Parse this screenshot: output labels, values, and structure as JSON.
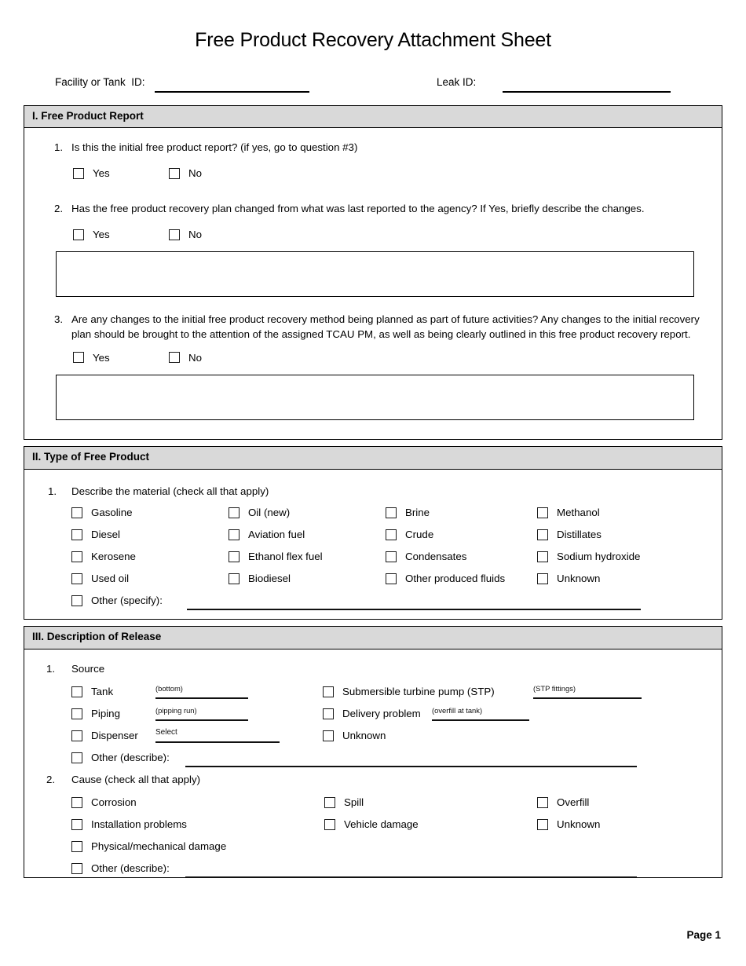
{
  "document": {
    "title": "Free Product Recovery Attachment Sheet",
    "footer": "Page 1"
  },
  "identifiers": {
    "facility_label": "Facility or Tank  ID:",
    "facility_value": "",
    "leak_label": "Leak ID:",
    "leak_value": ""
  },
  "sections": [
    {
      "heading": "I. Free Product Report",
      "questions": [
        {
          "number": "1.",
          "text": "Is this the initial free product report? (if yes, go to question #3)",
          "yes_label": "Yes",
          "no_label": "No",
          "comment_value": ""
        },
        {
          "number": "2.",
          "text": "Has the free product recovery plan changed from what was last reported to the agency? If Yes, briefly describe the changes.",
          "yes_label": "Yes",
          "no_label": "No",
          "comment_value": ""
        },
        {
          "number": "3.",
          "text": "Are any changes to the initial free product recovery method being planned as part of future activities?  Any changes to the initial recovery plan should be brought to the attention of the assigned TCAU PM, as well as being clearly outlined in this free product recovery report.",
          "yes_label": "Yes",
          "no_label": "No",
          "comment_value": ""
        }
      ]
    },
    {
      "heading": "II. Type of Free Product",
      "material": {
        "number": "1.",
        "prompt": "Describe the material (check all that apply)",
        "columns": [
          [
            "Gasoline",
            "Diesel",
            "Kerosene",
            "Used oil"
          ],
          [
            "Oil (new)",
            "Aviation fuel",
            "Ethanol flex fuel",
            "Biodiesel"
          ],
          [
            "Brine",
            "Crude",
            "Condensates",
            "Other produced fluids"
          ],
          [
            "Methanol",
            "Distillates",
            "Sodium hydroxide",
            "Unknown"
          ]
        ],
        "other_label": "Other (specify):",
        "other_value": ""
      }
    },
    {
      "heading": "III. Description of Release",
      "source": {
        "number": "1.",
        "prompt": "Source",
        "left": [
          {
            "label": "Tank",
            "hint": "(bottom)",
            "value": ""
          },
          {
            "label": "Piping",
            "hint": "(pipping run)",
            "value": ""
          },
          {
            "label": "Dispenser",
            "hint": "Select",
            "value": ""
          }
        ],
        "right": [
          {
            "label": "Submersible turbine pump (STP)",
            "hint": "(STP fittings)",
            "value": ""
          },
          {
            "label": "Delivery problem",
            "hint": "(overfill at tank)",
            "value": ""
          },
          {
            "label": "Unknown",
            "hint": "",
            "value": ""
          }
        ],
        "other_label": "Other (describe):",
        "other_value": ""
      },
      "cause": {
        "number": "2.",
        "prompt": "Cause (check all that apply)",
        "columns": [
          [
            "Corrosion",
            "Installation problems",
            "Physical/mechanical damage"
          ],
          [
            "Spill",
            "Vehicle damage"
          ],
          [
            "Overfill",
            "Unknown"
          ]
        ],
        "other_label": "Other (describe):",
        "other_value": ""
      }
    }
  ]
}
